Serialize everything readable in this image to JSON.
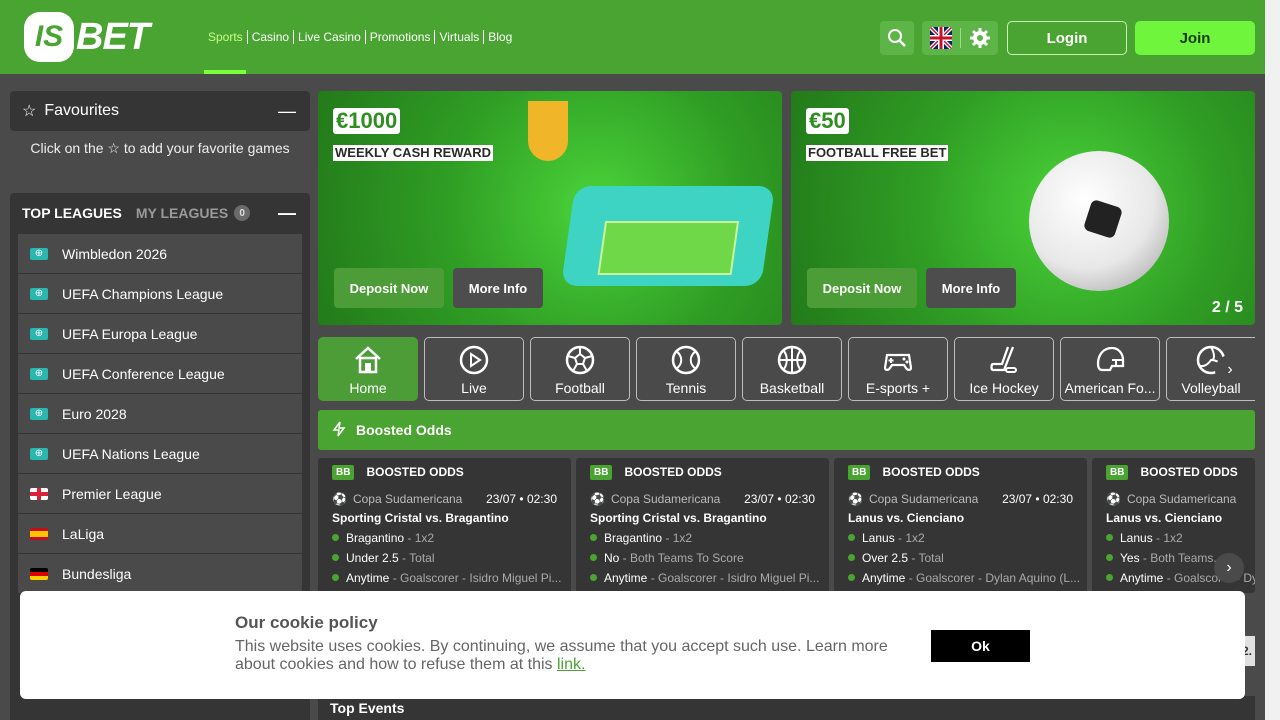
{
  "brand": {
    "badge": "IS",
    "name": "BET"
  },
  "nav": [
    "Sports",
    "Casino",
    "Live Casino",
    "Promotions",
    "Virtuals",
    "Blog"
  ],
  "header": {
    "login": "Login",
    "join": "Join"
  },
  "favourites": {
    "title": "Favourites",
    "hint": "Click on the ☆ to add your favorite games"
  },
  "leagues": {
    "tab_top": "TOP LEAGUES",
    "tab_my": "MY LEAGUES",
    "my_count": "0",
    "items": [
      {
        "label": "Wimbledon 2026",
        "icon": "globe"
      },
      {
        "label": "UEFA Champions League",
        "icon": "globe"
      },
      {
        "label": "UEFA Europa League",
        "icon": "globe"
      },
      {
        "label": "UEFA Conference League",
        "icon": "globe"
      },
      {
        "label": "Euro 2028",
        "icon": "globe"
      },
      {
        "label": "UEFA Nations League",
        "icon": "globe"
      },
      {
        "label": "Premier League",
        "icon": "england-flag"
      },
      {
        "label": "LaLiga",
        "icon": "spain-flag"
      },
      {
        "label": "Bundesliga",
        "icon": "germany-flag"
      }
    ]
  },
  "banners": [
    {
      "amount": "€1000",
      "subtitle": "WEEKLY CASH REWARD",
      "primary": "Deposit Now",
      "secondary": "More Info"
    },
    {
      "amount": "€50",
      "subtitle": "FOOTBALL FREE BET",
      "primary": "Deposit Now",
      "secondary": "More Info",
      "pager": "2 / 5"
    }
  ],
  "categories": [
    "Home",
    "Live",
    "Football",
    "Tennis",
    "Basketball",
    "E-sports +",
    "Ice Hockey",
    "American Fo...",
    "Volleyball"
  ],
  "boosted": {
    "title": "Boosted Odds",
    "cards": [
      {
        "badge": "BB",
        "label": "BOOSTED ODDS",
        "league": "Copa Sudamericana",
        "date": "23/07 • 02:30",
        "match": "Sporting Cristal vs. Bragantino",
        "sel1": "Bragantino",
        "sel1_type": " - 1x2",
        "sel2": "Under 2.5",
        "sel2_type": " - Total",
        "sel3": "Anytime",
        "sel3_type": " - Goalscorer - Isidro Miguel Pi..."
      },
      {
        "badge": "BB",
        "label": "BOOSTED ODDS",
        "league": "Copa Sudamericana",
        "date": "23/07 • 02:30",
        "match": "Sporting Cristal vs. Bragantino",
        "sel1": "Bragantino",
        "sel1_type": " - 1x2",
        "sel2": "No",
        "sel2_type": " - Both Teams To Score",
        "sel3": "Anytime",
        "sel3_type": " - Goalscorer - Isidro Miguel Pi..."
      },
      {
        "badge": "BB",
        "label": "BOOSTED ODDS",
        "league": "Copa Sudamericana",
        "date": "23/07 • 02:30",
        "match": "Lanus vs. Cienciano",
        "sel1": "Lanus",
        "sel1_type": " - 1x2",
        "sel2": "Over 2.5",
        "sel2_type": " - Total",
        "sel3": "Anytime",
        "sel3_type": " - Goalscorer - Dylan Aquino (L..."
      },
      {
        "badge": "BB",
        "label": "BOOSTED ODDS",
        "league": "Copa Sudamericana",
        "date": "",
        "match": "Lanus vs. Cienciano",
        "sel1": "Lanus",
        "sel1_type": " - 1x2",
        "sel2": "Yes",
        "sel2_type": " - Both Teams...",
        "sel3": "Anytime",
        "sel3_type": " - Goalscorer - Dy..."
      }
    ]
  },
  "top_events": "Top Events",
  "peek_text": "2.",
  "cookie": {
    "title": "Our cookie policy",
    "text": "This website uses cookies. By continuing, we assume that you accept such use. Learn more about cookies and how to refuse them at this ",
    "link": "link.",
    "ok": "Ok"
  },
  "colors": {
    "brand_green": "#4aa432",
    "join_green": "#6ef53c",
    "dark_panel": "#353535",
    "background": "#4a4a4a"
  }
}
